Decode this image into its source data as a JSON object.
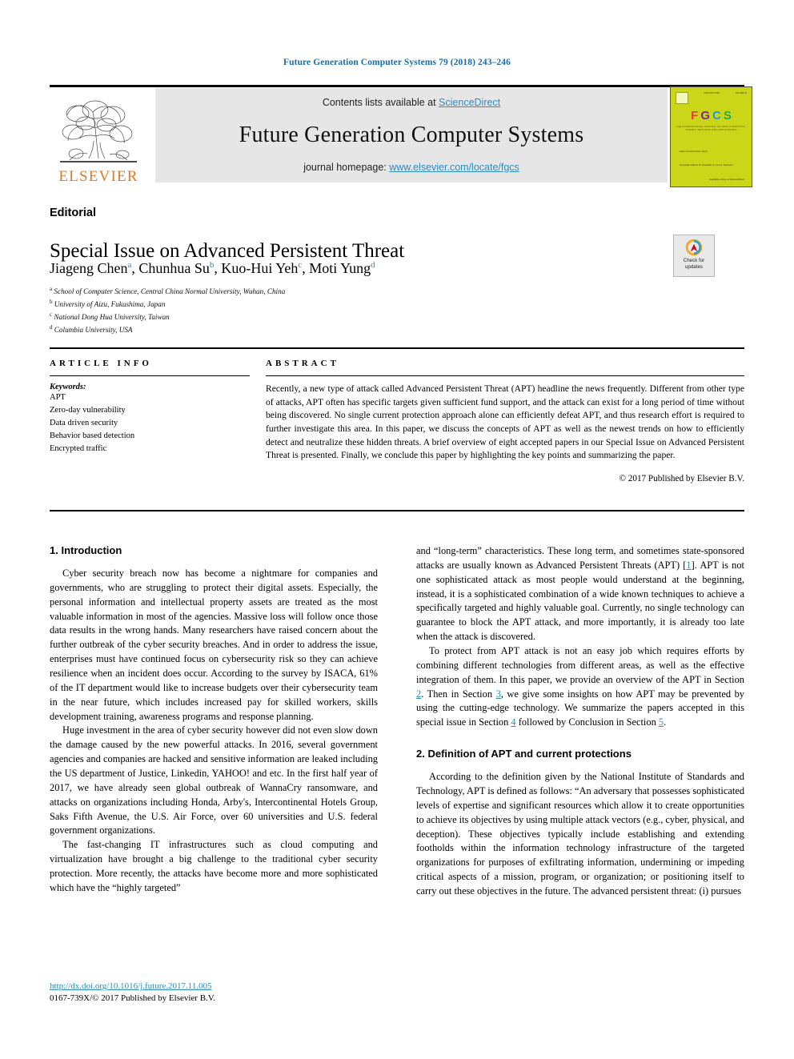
{
  "running_head": "Future Generation Computer Systems 79 (2018) 243–246",
  "masthead": {
    "publisher_logo_word": "ELSEVIER",
    "contents_prefix": "Contents lists available at ",
    "contents_link": "ScienceDirect",
    "journal_name": "Future Generation Computer Systems",
    "homepage_prefix": "journal homepage: ",
    "homepage_url": "www.elsevier.com/locate/fgcs",
    "cover": {
      "letters": [
        "F",
        "G",
        "C",
        "S"
      ],
      "subtitle": "THE INTERNATIONAL JOURNAL OF GRID COMPUTING: THEORY, METHODS AND APPLICATIONS",
      "header_left": "ISSN 0167-739X",
      "header_right": "VOLUME 79",
      "block1": "Editor-in-Chief\nPeter Sloot",
      "block2": "Associate Editors\nM. Parashar\nG. Fox\nE. Deelman",
      "footer": "Available online at\nScienceDirect"
    }
  },
  "article": {
    "type_label": "Editorial",
    "title": "Special Issue on Advanced Persistent Threat",
    "authors": [
      {
        "name": "Jiageng Chen",
        "marker": "a"
      },
      {
        "name": "Chunhua Su",
        "marker": "b"
      },
      {
        "name": "Kuo-Hui Yeh",
        "marker": "c"
      },
      {
        "name": "Moti Yung",
        "marker": "d"
      }
    ],
    "affiliations": [
      {
        "marker": "a",
        "text": "School of Computer Science, Central China Normal University, Wuhan, China"
      },
      {
        "marker": "b",
        "text": "University of Aizu, Fukushima, Japan"
      },
      {
        "marker": "c",
        "text": "National Dong Hua University, Taiwan"
      },
      {
        "marker": "d",
        "text": "Columbia University, USA"
      }
    ],
    "crossmark_label": "Check for\nupdates"
  },
  "info": {
    "heading": "ARTICLE INFO",
    "keywords_label": "Keywords:",
    "keywords": [
      "APT",
      "Zero-day vulnerability",
      "Data driven security",
      "Behavior based detection",
      "Encrypted traffic"
    ]
  },
  "abstract": {
    "heading": "ABSTRACT",
    "text": "Recently, a new type of attack called Advanced Persistent Threat (APT) headline the news frequently. Different from other type of attacks, APT often has specific targets given sufficient fund support, and the attack can exist for a long period of time without being discovered. No single current protection approach alone can efficiently defeat APT, and thus research effort is required to further investigate this area. In this paper, we discuss the concepts of APT as well as the newest trends on how to efficiently detect and neutralize these hidden threats. A brief overview of eight accepted papers in our Special Issue on Advanced Persistent Threat is presented. Finally, we conclude this paper by highlighting the key points and summarizing the paper.",
    "copyright": "© 2017 Published by Elsevier B.V."
  },
  "body": {
    "left": {
      "section1_heading": "1. Introduction",
      "para1": "Cyber security breach now has become a nightmare for companies and governments, who are struggling to protect their digital assets. Especially, the personal information and intellectual property assets are treated as the most valuable information in most of the agencies. Massive loss will follow once those data results in the wrong hands. Many researchers have raised concern about the further outbreak of the cyber security breaches. And in order to address the issue, enterprises must have continued focus on cybersecurity risk so they can achieve resilience when an incident does occur. According to the survey by ISACA, 61% of the IT department would like to increase budgets over their cybersecurity team in the near future, which includes increased pay for skilled workers, skills development training, awareness programs and response planning.",
      "para2": "Huge investment in the area of cyber security however did not even slow down the damage caused by the new powerful attacks. In 2016, several government agencies and companies are hacked and sensitive information are leaked including the US department of Justice, Linkedin, YAHOO! and etc. In the first half year of 2017, we have already seen global outbreak of WannaCry ransomware, and attacks on organizations including Honda, Arby's, Intercontinental Hotels Group, Saks Fifth Avenue, the U.S. Air Force, over 60 universities and U.S. federal government organizations.",
      "para3": "The fast-changing IT infrastructures such as cloud computing and virtualization have brought a big challenge to the traditional cyber security protection. More recently, the attacks have become more and more sophisticated which have the “highly targeted”"
    },
    "right": {
      "para1_a": "and “long-term” characteristics. These long term, and sometimes state-sponsored attacks are usually known as Advanced Persistent Threats (APT) [",
      "para1_ref": "1",
      "para1_b": "]. APT is not one sophisticated attack as most people would understand at the beginning, instead, it is a sophisticated combination of a wide known techniques to achieve a specifically targeted and highly valuable goal. Currently, no single technology can guarantee to block the APT attack, and more importantly, it is already too late when the attack is discovered.",
      "para2_a": "To protect from APT attack is not an easy job which requires efforts by combining different technologies from different areas, as well as the effective integration of them. In this paper, we provide an overview of the APT in Section ",
      "para2_ref1": "2",
      "para2_b": ". Then in Section ",
      "para2_ref2": "3",
      "para2_c": ", we give some insights on how APT may be prevented by using the cutting-edge technology. We summarize the papers accepted in this special issue in Section ",
      "para2_ref3": "4",
      "para2_d": " followed by Conclusion in Section ",
      "para2_ref4": "5",
      "para2_e": ".",
      "section2_heading": "2. Definition of APT and current protections",
      "para3": "According to the definition given by the National Institute of Standards and Technology, APT is defined as follows: “An adversary that possesses sophisticated levels of expertise and significant resources which allow it to create opportunities to achieve its objectives by using multiple attack vectors (e.g., cyber, physical, and deception). These objectives typically include establishing and extending footholds within the information technology infrastructure of the targeted organizations for purposes of exfiltrating information, undermining or impeding critical aspects of a mission, program, or organization; or positioning itself to carry out these objectives in the future. The advanced persistent threat: (i) pursues"
    }
  },
  "footer": {
    "doi": "http://dx.doi.org/10.1016/j.future.2017.11.005",
    "issn": "0167-739X/© 2017 Published by Elsevier B.V."
  },
  "colors": {
    "link_blue": "#2e8bc0",
    "header_blue": "#1b6ca8",
    "elsevier_orange": "#e87722",
    "band_gray": "#e6e6e6",
    "cover_yellow": "#ccd619"
  }
}
